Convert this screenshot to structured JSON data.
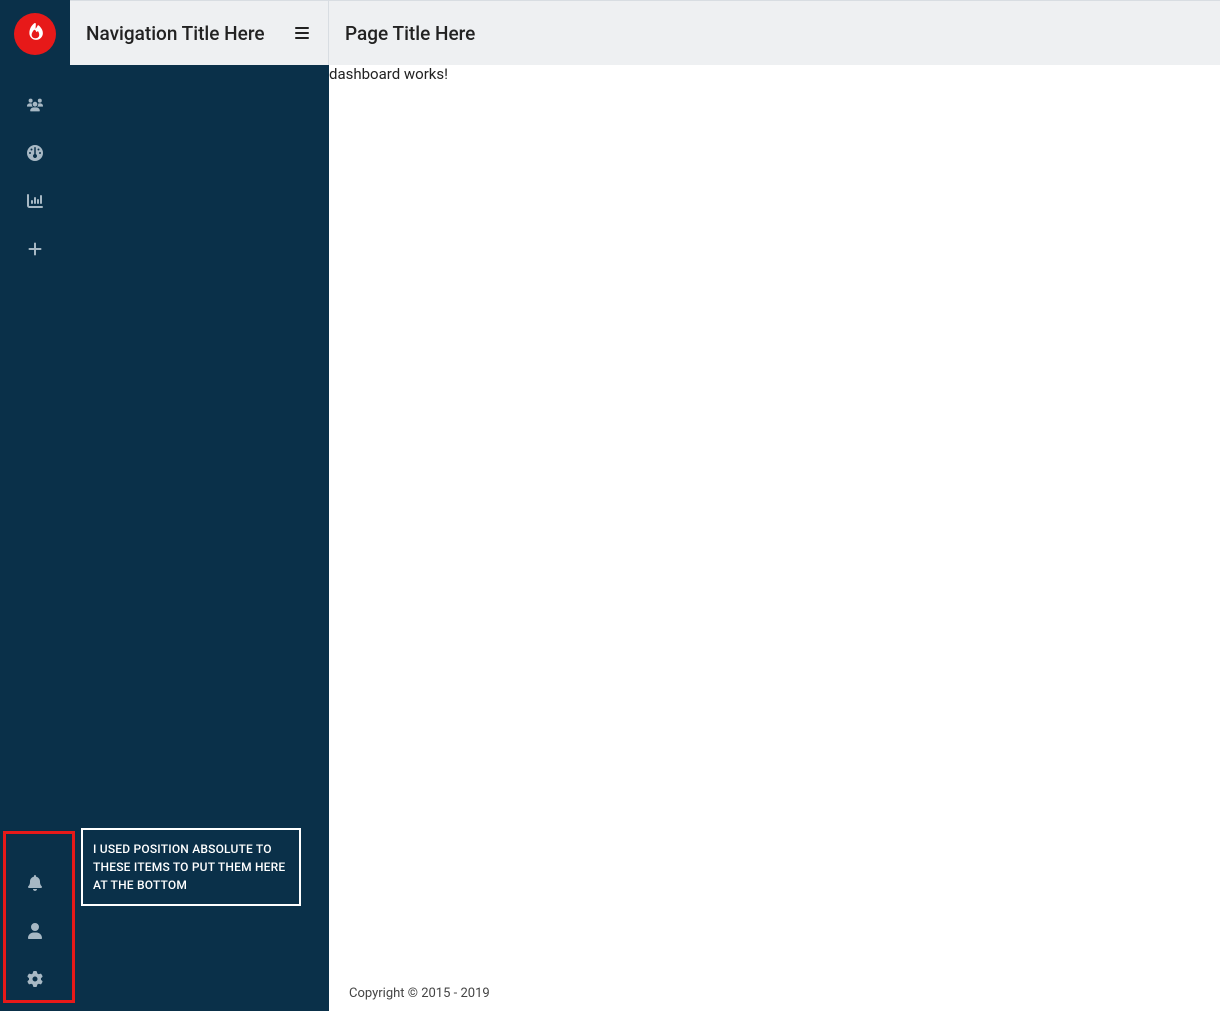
{
  "logo": {
    "iconName": "fire-icon"
  },
  "iconRail": {
    "topIcons": [
      {
        "name": "users-icon"
      },
      {
        "name": "gauge-icon"
      },
      {
        "name": "chart-bar-icon"
      },
      {
        "name": "plus-icon"
      }
    ],
    "bottomIcons": [
      {
        "name": "bell-icon"
      },
      {
        "name": "user-icon"
      },
      {
        "name": "gear-icon"
      }
    ]
  },
  "navPanel": {
    "title": "Navigation Title Here"
  },
  "page": {
    "title": "Page Title Here",
    "bodyText": "dashboard works!"
  },
  "annotation": {
    "text": "I USED POSITION ABSOLUTE TO THESE ITEMS TO PUT THEM HERE AT THE BOTTOM"
  },
  "footer": {
    "text": "Copyright © 2015 - 2019"
  }
}
